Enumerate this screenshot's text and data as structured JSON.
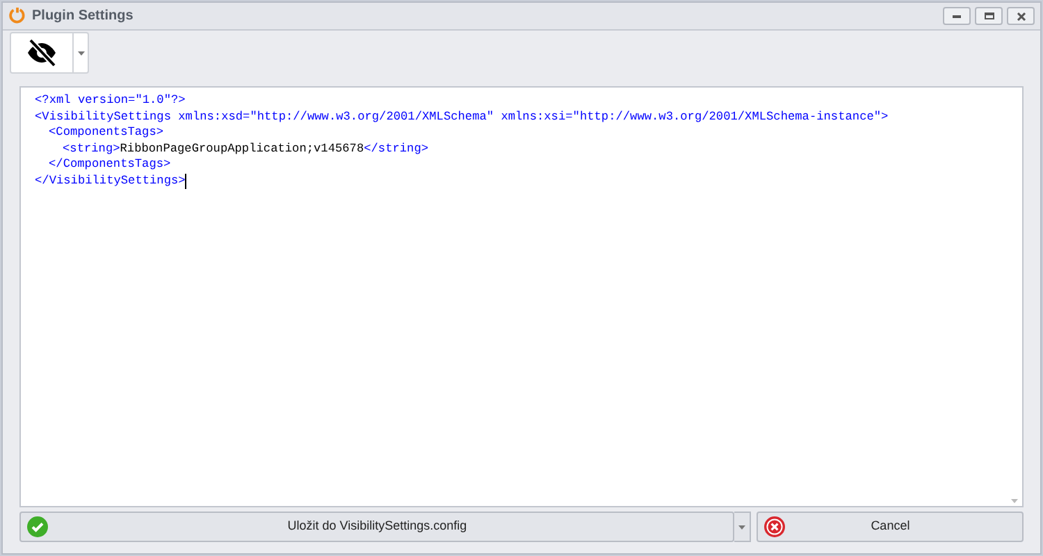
{
  "window": {
    "title": "Plugin Settings"
  },
  "editor": {
    "declaration": "<?xml version=\"1.0\"?>",
    "nodes": [
      {
        "open": "<VisibilitySettings xmlns:xsd=\"http://www.w3.org/2001/XMLSchema\" xmlns:xsi=\"http://www.w3.org/2001/XMLSchema-instance\">",
        "close": "</VisibilitySettings>",
        "children": [
          {
            "open": "<ComponentsTags>",
            "close": "</ComponentsTags>",
            "children": [
              {
                "open": "<string>",
                "content": "RibbonPageGroupApplication;v145678",
                "close": "</string>"
              }
            ]
          }
        ]
      }
    ]
  },
  "buttons": [
    {
      "label": "Uložit do VisibilitySettings.config",
      "kind": "ok"
    },
    {
      "label": "Cancel",
      "kind": "cancel"
    }
  ]
}
